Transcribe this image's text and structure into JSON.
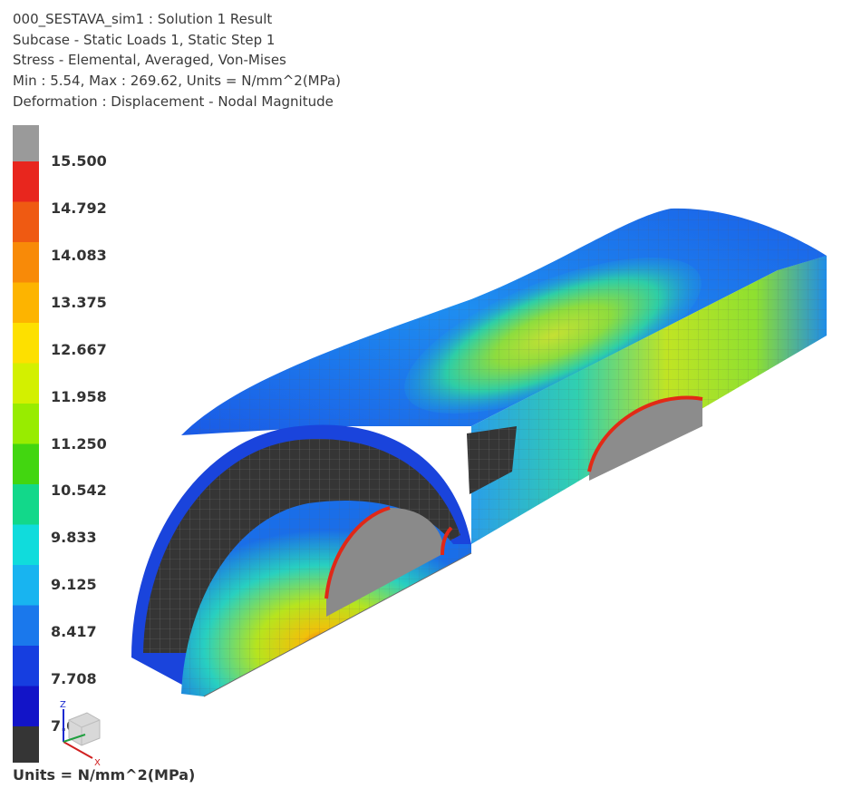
{
  "header": {
    "lines": [
      "000_SESTAVA_sim1 : Solution 1 Result",
      "Subcase - Static Loads 1, Static Step 1",
      "Stress - Elemental, Averaged, Von-Mises",
      "Min : 5.54, Max : 269.62, Units = N/mm^2(MPa)",
      "Deformation : Displacement - Nodal Magnitude"
    ]
  },
  "legend": {
    "labels": [
      "15.500",
      "14.792",
      "14.083",
      "13.375",
      "12.667",
      "11.958",
      "11.250",
      "10.542",
      "9.833",
      "9.125",
      "8.417",
      "7.708",
      "7.000"
    ],
    "units": "Units = N/mm^2(MPa)",
    "overflow_color": "#9a9a9a",
    "underflow_color": "#353535",
    "band_colors": [
      "#e8261e",
      "#ef5a12",
      "#f88a08",
      "#fdb400",
      "#fde000",
      "#d3f000",
      "#98ec00",
      "#42d610",
      "#12d88a",
      "#10dcdc",
      "#18b4f0",
      "#1a78ec",
      "#163ee0",
      "#1214c8"
    ]
  },
  "triad": {
    "z_label": "Z",
    "x_label": "X"
  }
}
